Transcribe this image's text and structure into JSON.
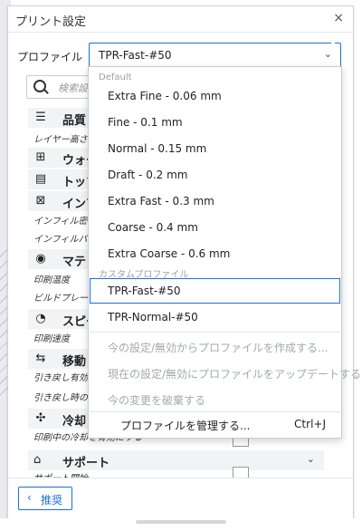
{
  "window": {
    "title": "プリント設定",
    "close_glyph": "×"
  },
  "profile": {
    "label": "プロファイル",
    "value": "TPR-Fast-#50",
    "chevron": "⌄"
  },
  "search": {
    "placeholder": "検索設定"
  },
  "categories": [
    {
      "icon": "quality-icon",
      "glyph": "☰",
      "label": "品質"
    },
    {
      "icon": "wall-icon",
      "glyph": "⊞",
      "label": "ウォール"
    },
    {
      "icon": "topbottom-icon",
      "glyph": "▤",
      "label": "トップ/ボトム"
    },
    {
      "icon": "infill-icon",
      "glyph": "⊠",
      "label": "インフィル"
    },
    {
      "icon": "material-icon",
      "glyph": "◉",
      "label": "マテリアル"
    },
    {
      "icon": "speed-icon",
      "glyph": "◔",
      "label": "スピード"
    },
    {
      "icon": "travel-icon",
      "glyph": "⇆",
      "label": "移動"
    },
    {
      "icon": "cooling-icon",
      "glyph": "✣",
      "label": "冷却"
    }
  ],
  "settings": {
    "layer_height": "レイヤー高さ",
    "infill_density": "インフィル密度",
    "infill_pattern": "インフィルパターン",
    "print_temp": "印刷温度",
    "build_plate_temp": "ビルドプレート温度",
    "print_speed": "印刷速度",
    "retraction_enable": "引き戻し有効",
    "retraction_travel": "引き戻し時の移動",
    "cooling_enable": "印刷中の冷却を有効にする",
    "support_generate": "サポート開始"
  },
  "support": {
    "label": "サポート",
    "glyph": "⌂",
    "chevron": "⌄"
  },
  "footer": {
    "recommended_label": "推奨",
    "chevron": "‹"
  },
  "dropdown": {
    "default_header": "Default",
    "default_items": [
      "Extra Fine - 0.06 mm",
      "Fine - 0.1 mm",
      "Normal - 0.15 mm",
      "Draft - 0.2 mm",
      "Extra Fast - 0.3 mm",
      "Coarse - 0.4 mm",
      "Extra Coarse - 0.6 mm"
    ],
    "custom_header": "カスタムプロファイル",
    "custom_items": [
      "TPR-Fast-#50",
      "TPR-Normal-#50"
    ],
    "actions": [
      "今の設定/無効からプロファイルを作成する...",
      "現在の設定/無効にプロファイルをアップデートする",
      "今の変更を破棄する"
    ],
    "manage_label": "プロファイルを管理する...",
    "manage_shortcut": "Ctrl+J"
  },
  "colors": {
    "accent": "#1b71d1",
    "disabled": "#a4a9ae"
  }
}
